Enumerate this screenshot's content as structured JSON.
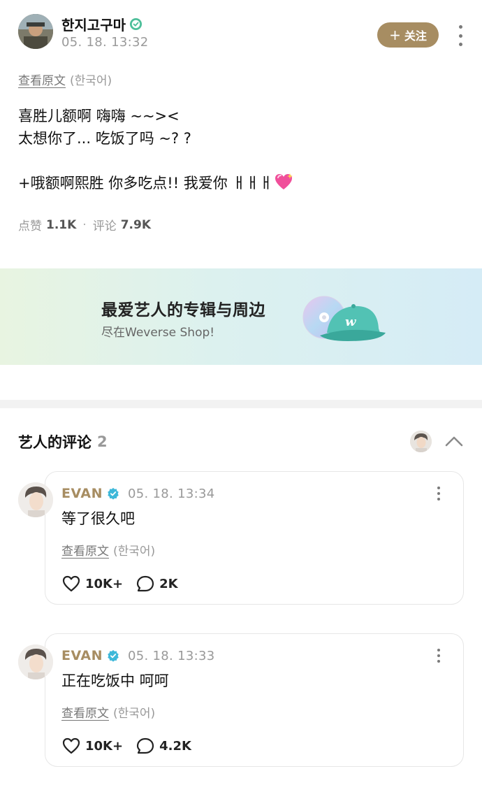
{
  "post": {
    "author": "한지고구마",
    "time": "05. 18. 13:32",
    "follow_label": "关注",
    "translate_link": "查看原文",
    "translate_lang": "(한국어)",
    "lines": [
      "喜胜儿额啊 嗨嗨 ~~><",
      "太想你了... 吃饭了吗 ~? ?",
      "",
      "+哦额啊熙胜 你多吃点!! 我爱你 ㅐㅐㅐ"
    ],
    "likes_label": "点赞",
    "likes": "1.1K",
    "comments_label": "评论",
    "comments": "7.9K"
  },
  "banner": {
    "title": "最爱艺人的专辑与周边",
    "subtitle": "尽在Weverse Shop!"
  },
  "artist_comments": {
    "title": "艺人的评论",
    "count": "2",
    "items": [
      {
        "author": "EVAN",
        "time": "05. 18. 13:34",
        "text": "等了很久吧",
        "translate_link": "查看原文",
        "translate_lang": "(한국어)",
        "likes": "10K+",
        "replies": "2K"
      },
      {
        "author": "EVAN",
        "time": "05. 18. 13:33",
        "text": "正在吃饭中 呵呵",
        "translate_link": "查看原文",
        "translate_lang": "(한국어)",
        "likes": "10K+",
        "replies": "4.2K"
      }
    ]
  },
  "colors": {
    "accent": "#a78d62",
    "verified": "#4dbf9a",
    "comment_verified": "#3db8d9"
  },
  "icons": [
    "verified-icon",
    "more-icon",
    "heart-icon",
    "reply-bubble-icon",
    "chevron-up-icon"
  ]
}
